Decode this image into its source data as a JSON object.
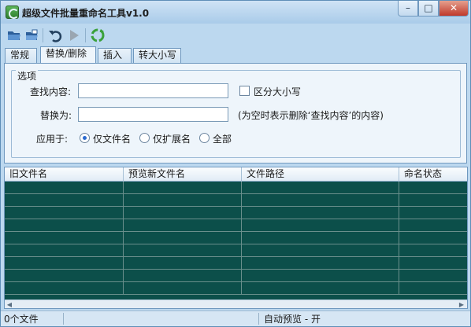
{
  "window": {
    "title": "超级文件批量重命名工具v1.0",
    "controls": {
      "minimize": "–",
      "maximize": "□",
      "close": "✕"
    }
  },
  "toolbar": {
    "buttons": [
      {
        "icon": "open-folder-icon"
      },
      {
        "icon": "open-files-icon"
      },
      {
        "icon": "undo-icon"
      },
      {
        "icon": "play-icon"
      },
      {
        "icon": "recycle-icon"
      }
    ]
  },
  "tabs": [
    {
      "label": "常规",
      "active": false
    },
    {
      "label": "替换/删除",
      "active": true
    },
    {
      "label": "插入",
      "active": false
    },
    {
      "label": "转大小写",
      "active": false
    }
  ],
  "options": {
    "legend": "选项",
    "find_label": "查找内容:",
    "find_value": "",
    "case_label": "区分大小写",
    "case_checked": false,
    "replace_label": "替换为:",
    "replace_value": "",
    "replace_hint": "(为空时表示删除‘查找内容’的内容)",
    "apply_label": "应用于:",
    "apply_options": [
      {
        "label": "仅文件名",
        "checked": true
      },
      {
        "label": "仅扩展名",
        "checked": false
      },
      {
        "label": "全部",
        "checked": false
      }
    ]
  },
  "table": {
    "columns": [
      "旧文件名",
      "预览新文件名",
      "文件路径",
      "命名状态"
    ],
    "rows": []
  },
  "status": {
    "file_count": "0个文件",
    "preview_mode": "自动预览 - 开"
  },
  "colors": {
    "grid_background": "#0c4f4a",
    "window_background": "#bcd8ef",
    "close_button": "#c0392b"
  }
}
